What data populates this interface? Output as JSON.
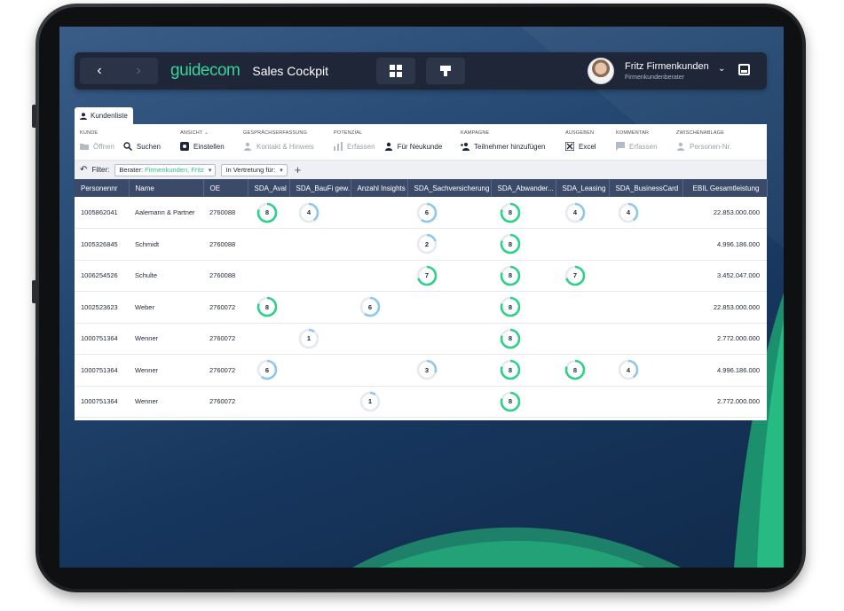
{
  "header": {
    "back_glyph": "‹",
    "forward_glyph": "›",
    "logo": "guidecom",
    "app_title": "Sales Cockpit",
    "user_name": "Fritz Firmenkunden",
    "user_role": "Firmenkundenberater"
  },
  "tab": {
    "label": "Kundenliste"
  },
  "ribbon": {
    "groups": [
      {
        "label": "KUNDE",
        "items": [
          {
            "label": "Öffnen",
            "icon": "folder-icon"
          },
          {
            "label": "Suchen",
            "icon": "search-icon"
          }
        ]
      },
      {
        "label": "ANSICHT",
        "items": [
          {
            "label": "Einstellen",
            "icon": "gear-icon"
          }
        ]
      },
      {
        "label": "GESPRÄCHSERFASSUNG",
        "items": [
          {
            "label": "Kontakt & Hinweis",
            "icon": "contact-icon"
          }
        ]
      },
      {
        "label": "POTENZIAL",
        "items": [
          {
            "label": "Erfassen",
            "icon": "bar-chart-icon"
          },
          {
            "label": "Für Neukunde",
            "icon": "person-icon"
          }
        ]
      },
      {
        "label": "KAMPAGNE",
        "items": [
          {
            "label": "Teilnehmer hinzufügen",
            "icon": "add-people-icon"
          }
        ]
      },
      {
        "label": "AUSGEBEN",
        "items": [
          {
            "label": "Excel",
            "icon": "excel-icon"
          }
        ]
      },
      {
        "label": "KOMMENTAR",
        "items": [
          {
            "label": "Erfassen",
            "icon": "comment-icon"
          }
        ]
      },
      {
        "label": "ZWISCHENABLAGE",
        "items": [
          {
            "label": "Personen-Nr.",
            "icon": "person-icon"
          }
        ]
      }
    ]
  },
  "filter": {
    "label": "Filter:",
    "berater_prefix": "Berater:",
    "berater_value": "Firmenkunden, Fritz",
    "vertretung": "In Vertretung für:",
    "add_glyph": "+"
  },
  "table": {
    "columns": [
      "Personennr",
      "Name",
      "OE",
      "SDA_Aval",
      "SDA_BauFi gew.",
      "Anzahl Insights",
      "SDA_Sachversicherung",
      "SDA_Abwander...",
      "SDA_Leasing",
      "SDA_BusinessCard",
      "EBIL Gesamtleistung"
    ],
    "rows": [
      {
        "nr": "1005862041",
        "name": "Aalemann & Partner",
        "oe": "2760088",
        "scores": [
          8,
          4,
          null,
          6,
          8,
          4,
          4
        ],
        "ebil": "22.853.000.000"
      },
      {
        "nr": "1005326845",
        "name": "Schmidt",
        "oe": "2760088",
        "scores": [
          null,
          null,
          null,
          2,
          8,
          null,
          null
        ],
        "ebil": "4.996.186.000"
      },
      {
        "nr": "1006254526",
        "name": "Schulte",
        "oe": "2760088",
        "scores": [
          null,
          null,
          null,
          7,
          8,
          7,
          null
        ],
        "ebil": "3.452.047.000"
      },
      {
        "nr": "1002523623",
        "name": "Weber",
        "oe": "2760072",
        "scores": [
          8,
          null,
          6,
          null,
          8,
          null,
          null
        ],
        "ebil": "22.853.000.000"
      },
      {
        "nr": "1000751364",
        "name": "Wenner",
        "oe": "2760072",
        "scores": [
          null,
          1,
          null,
          null,
          8,
          null,
          null
        ],
        "ebil": "2.772.000.000"
      },
      {
        "nr": "1000751364",
        "name": "Wenner",
        "oe": "2760072",
        "scores": [
          6,
          null,
          null,
          3,
          8,
          8,
          4
        ],
        "ebil": "4.996.186.000"
      },
      {
        "nr": "1000751364",
        "name": "Wenner",
        "oe": "2760072",
        "scores": [
          null,
          null,
          1,
          null,
          8,
          null,
          null
        ],
        "ebil": "2.772.000.000"
      }
    ],
    "score_max": 10
  },
  "colors": {
    "accent_green": "#2fd18a",
    "light_blue": "#8fc8ea",
    "header_bg": "#3b4a68"
  }
}
